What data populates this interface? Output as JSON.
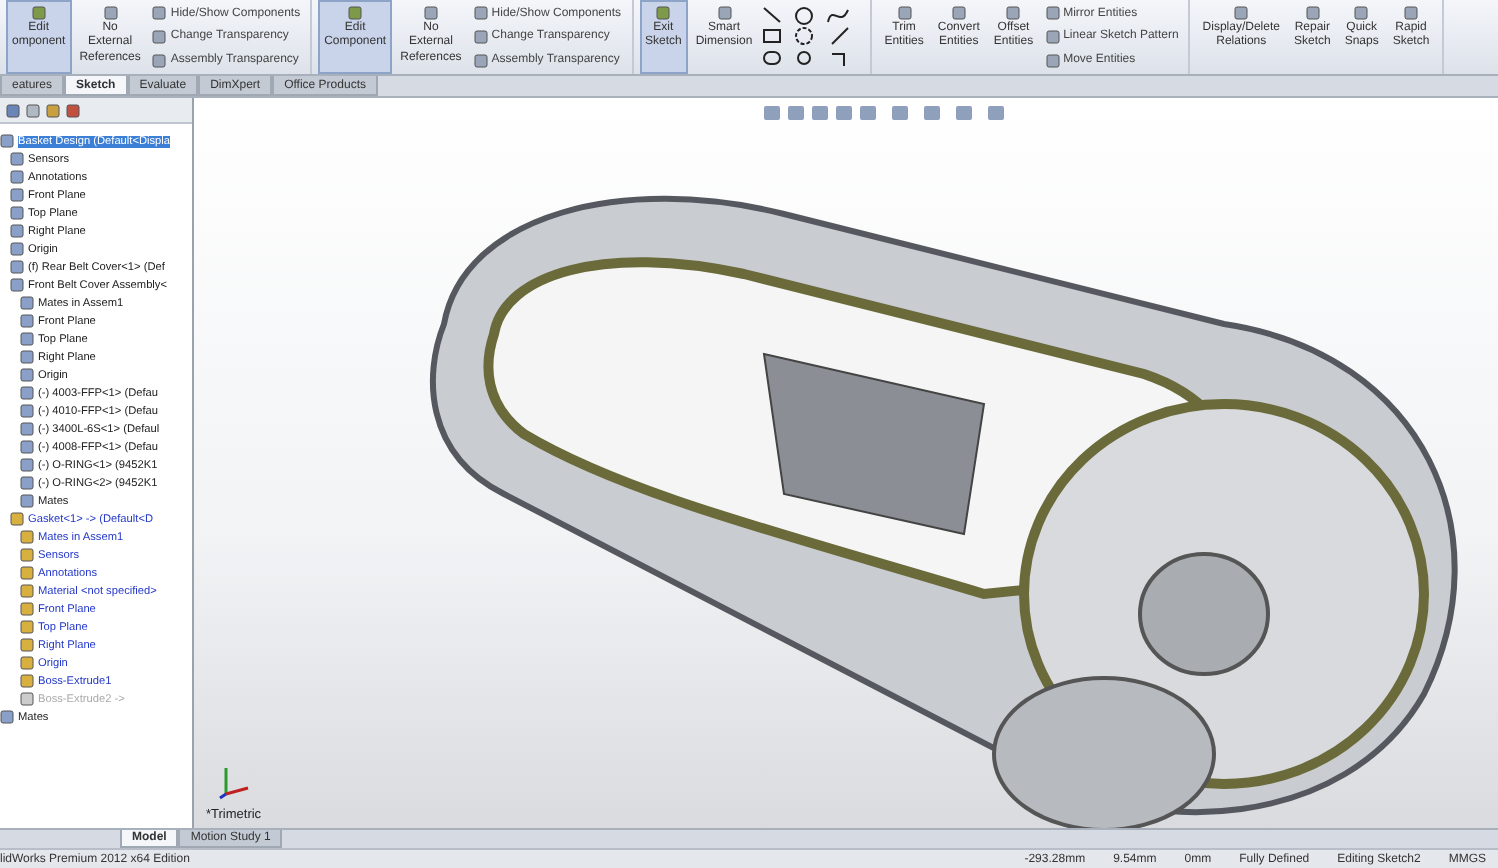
{
  "toolbar": {
    "groups": [
      {
        "large": [
          {
            "lines": [
              "Edit",
              "omponent"
            ],
            "selected": true
          },
          {
            "lines": [
              "No",
              "External",
              "References"
            ],
            "selected": false
          }
        ],
        "small": [
          "Hide/Show Components",
          "Change Transparency",
          "Assembly Transparency"
        ]
      },
      {
        "large": [
          {
            "lines": [
              "Edit",
              "Component"
            ],
            "selected": true
          },
          {
            "lines": [
              "No",
              "External",
              "References"
            ],
            "selected": false
          }
        ],
        "small": [
          "Hide/Show Components",
          "Change Transparency",
          "Assembly Transparency"
        ]
      },
      {
        "large": [
          {
            "lines": [
              "Exit",
              "Sketch"
            ],
            "selected": true
          },
          {
            "lines": [
              "Smart",
              "Dimension"
            ],
            "selected": false
          }
        ]
      },
      {
        "large": [
          {
            "lines": [
              "Trim",
              "Entities"
            ],
            "selected": false
          },
          {
            "lines": [
              "Convert",
              "Entities"
            ],
            "selected": false
          },
          {
            "lines": [
              "Offset",
              "Entities"
            ],
            "selected": false
          }
        ],
        "small": [
          "Mirror Entities",
          "Linear Sketch Pattern",
          "Move Entities"
        ]
      },
      {
        "large": [
          {
            "lines": [
              "Display/Delete",
              "Relations"
            ],
            "selected": false
          },
          {
            "lines": [
              "Repair",
              "Sketch"
            ],
            "selected": false
          },
          {
            "lines": [
              "Quick",
              "Snaps"
            ],
            "selected": false
          },
          {
            "lines": [
              "Rapid",
              "Sketch"
            ],
            "selected": false
          }
        ]
      }
    ]
  },
  "tabs": [
    {
      "label": "eatures",
      "selected": false
    },
    {
      "label": "Sketch",
      "selected": true
    },
    {
      "label": "Evaluate",
      "selected": false
    },
    {
      "label": "DimXpert",
      "selected": false
    },
    {
      "label": "Office Products",
      "selected": false
    }
  ],
  "tree": [
    {
      "label": "Basket Design  (Default<Displa",
      "kind": "normal",
      "selected": true,
      "children": [
        {
          "label": "Sensors",
          "kind": "normal",
          "selected": false
        },
        {
          "label": "Annotations",
          "kind": "normal",
          "selected": false
        },
        {
          "label": "Front Plane",
          "kind": "normal",
          "selected": false
        },
        {
          "label": "Top Plane",
          "kind": "normal",
          "selected": false
        },
        {
          "label": "Right Plane",
          "kind": "normal",
          "selected": false
        },
        {
          "label": "Origin",
          "kind": "normal",
          "selected": false
        },
        {
          "label": "(f) Rear Belt Cover<1> (Def",
          "kind": "normal",
          "selected": false
        },
        {
          "label": "Front Belt Cover Assembly<",
          "kind": "normal",
          "selected": false,
          "children": [
            {
              "label": "Mates in Assem1",
              "kind": "normal",
              "selected": false
            },
            {
              "label": "Front Plane",
              "kind": "normal",
              "selected": false
            },
            {
              "label": "Top Plane",
              "kind": "normal",
              "selected": false
            },
            {
              "label": "Right Plane",
              "kind": "normal",
              "selected": false
            },
            {
              "label": "Origin",
              "kind": "normal",
              "selected": false
            },
            {
              "label": "(-) 4003-FFP<1> (Defau",
              "kind": "normal",
              "selected": false
            },
            {
              "label": "(-) 4010-FFP<1> (Defau",
              "kind": "normal",
              "selected": false
            },
            {
              "label": "(-) 3400L-6S<1> (Defaul",
              "kind": "normal",
              "selected": false
            },
            {
              "label": "(-) 4008-FFP<1> (Defau",
              "kind": "normal",
              "selected": false
            },
            {
              "label": "(-) O-RING<1> (9452K1",
              "kind": "normal",
              "selected": false
            },
            {
              "label": "(-) O-RING<2> (9452K1",
              "kind": "normal",
              "selected": false
            },
            {
              "label": "Mates",
              "kind": "normal",
              "selected": false
            }
          ]
        },
        {
          "label": "Gasket<1> -> (Default<D",
          "kind": "editing",
          "selected": false,
          "children": [
            {
              "label": "Mates in Assem1",
              "kind": "editing",
              "selected": false
            },
            {
              "label": "Sensors",
              "kind": "editing",
              "selected": false
            },
            {
              "label": "Annotations",
              "kind": "editing",
              "selected": false
            },
            {
              "label": "Material <not specified>",
              "kind": "editing",
              "selected": false
            },
            {
              "label": "Front Plane",
              "kind": "editing",
              "selected": false
            },
            {
              "label": "Top Plane",
              "kind": "editing",
              "selected": false
            },
            {
              "label": "Right Plane",
              "kind": "editing",
              "selected": false
            },
            {
              "label": "Origin",
              "kind": "editing",
              "selected": false
            },
            {
              "label": "Boss-Extrude1",
              "kind": "editing",
              "selected": false
            },
            {
              "label": "Boss-Extrude2 ->",
              "kind": "suppressed",
              "selected": false
            }
          ]
        }
      ]
    },
    {
      "label": "Mates",
      "kind": "normal",
      "selected": false
    }
  ],
  "viewport": {
    "view_label": "*Trimetric"
  },
  "bottom_tabs": [
    {
      "label": "Model",
      "selected": true
    },
    {
      "label": "Motion Study 1",
      "selected": false
    }
  ],
  "status_bar": {
    "app": "lidWorks Premium 2012 x64 Edition",
    "fields": [
      "-293.28mm",
      "9.54mm",
      "0mm",
      "Fully Defined",
      "Editing Sketch2",
      "MMGS"
    ]
  }
}
